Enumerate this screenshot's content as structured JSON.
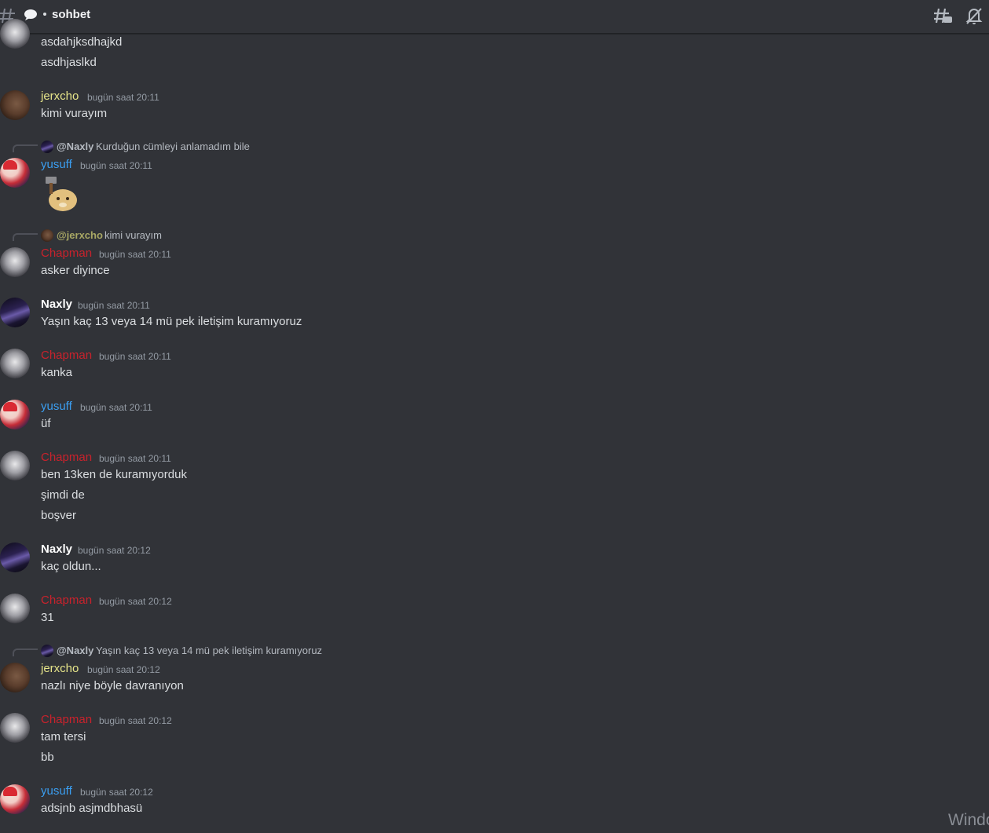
{
  "header": {
    "channel_name": "sohbet"
  },
  "timestamps": {
    "t2011": "bugün saat 20:11",
    "t2012": "bugün saat 20:12"
  },
  "users": {
    "jerxcho": "jerxcho",
    "yusuff": "yusuff",
    "chapman": "Chapman",
    "naxly": "Naxly"
  },
  "replies": {
    "r1": {
      "name": "@Naxly",
      "text": "Kurduğun cümleyi anlamadım bile"
    },
    "r2": {
      "name": "@jerxcho",
      "text": "kimi vurayım"
    },
    "r3": {
      "name": "@Naxly",
      "text": "Yaşın kaç 13 veya 14 mü pek iletişim kuramıyoruz"
    }
  },
  "messages": {
    "m0a": "asdahjksdhajkd",
    "m0b": "asdhjaslkd",
    "m1": "kimi vurayım",
    "m3": "asker diyince",
    "m4": "Yaşın kaç 13 veya 14 mü pek iletişim kuramıyoruz",
    "m5": "kanka",
    "m6": "üf",
    "m7a": "ben 13ken de kuramıyorduk",
    "m7b": "şimdi de",
    "m7c": "boşver",
    "m8": "kaç oldun...",
    "m9": "31",
    "m10": "nazlı niye böyle davranıyon",
    "m11a": "tam tersi",
    "m11b": "bb",
    "m12": "adsjnb asjmdbhasü"
  },
  "watermark": "Windo"
}
